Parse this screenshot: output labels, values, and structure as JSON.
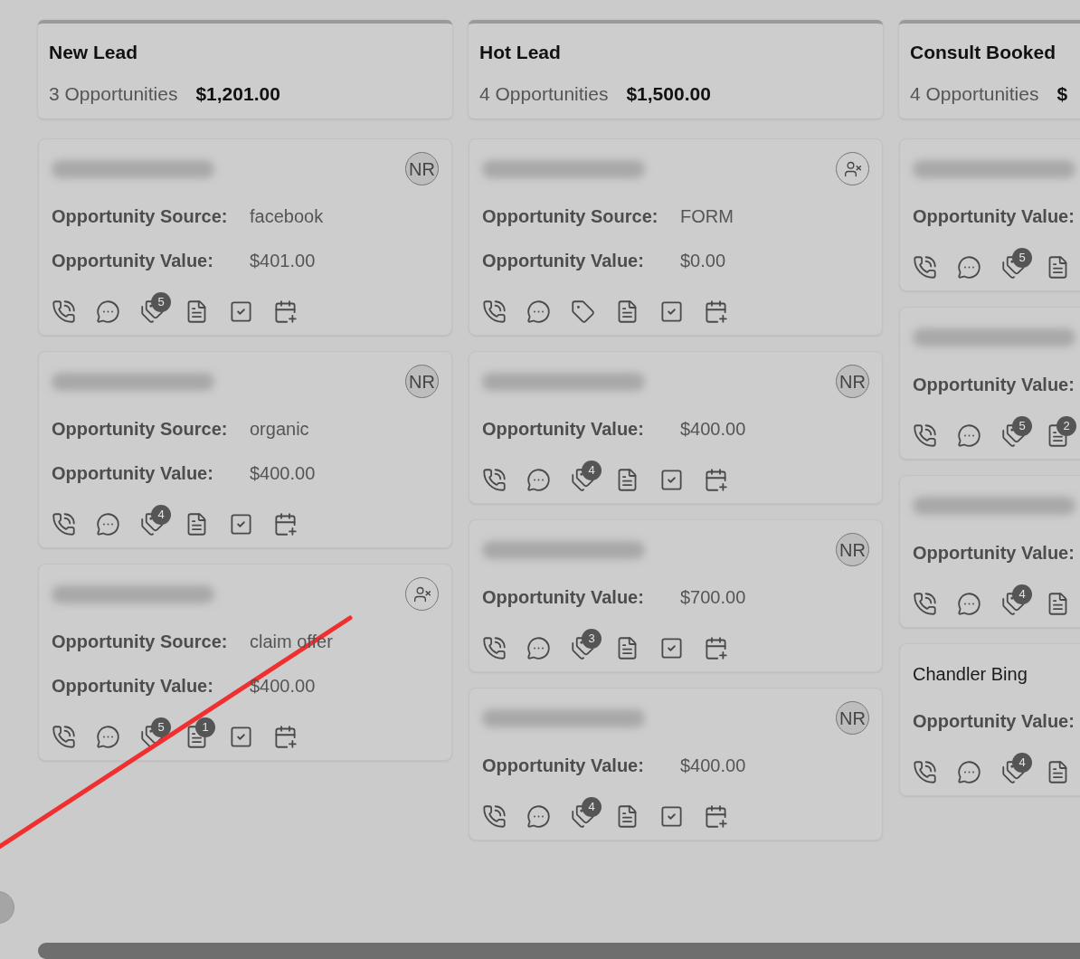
{
  "columns": [
    {
      "title": "New Lead",
      "count": "3 Opportunities",
      "total": "$1,201.00",
      "cards": [
        {
          "avatar": {
            "kind": "initials",
            "text": "NR"
          },
          "fields": [
            {
              "label": "Opportunity Source:",
              "value": "facebook"
            },
            {
              "label": "Opportunity Value:",
              "value": "$401.00"
            }
          ],
          "tag_badge": "5"
        },
        {
          "avatar": {
            "kind": "initials",
            "text": "NR"
          },
          "fields": [
            {
              "label": "Opportunity Source:",
              "value": "organic"
            },
            {
              "label": "Opportunity Value:",
              "value": "$400.00"
            }
          ],
          "tag_badge": "4"
        },
        {
          "avatar": {
            "kind": "unassigned"
          },
          "fields": [
            {
              "label": "Opportunity Source:",
              "value": "claim offer"
            },
            {
              "label": "Opportunity Value:",
              "value": "$400.00"
            }
          ],
          "tag_badge": "5",
          "note_badge": "1"
        }
      ]
    },
    {
      "title": "Hot Lead",
      "count": "4 Opportunities",
      "total": "$1,500.00",
      "cards": [
        {
          "avatar": {
            "kind": "unassigned"
          },
          "fields": [
            {
              "label": "Opportunity Source:",
              "value": "FORM"
            },
            {
              "label": "Opportunity Value:",
              "value": "$0.00"
            }
          ]
        },
        {
          "avatar": {
            "kind": "initials",
            "text": "NR"
          },
          "fields": [
            {
              "label": "Opportunity Value:",
              "value": "$400.00"
            }
          ],
          "tag_badge": "4"
        },
        {
          "avatar": {
            "kind": "initials",
            "text": "NR"
          },
          "fields": [
            {
              "label": "Opportunity Value:",
              "value": "$700.00"
            }
          ],
          "tag_badge": "3"
        },
        {
          "avatar": {
            "kind": "initials",
            "text": "NR"
          },
          "fields": [
            {
              "label": "Opportunity Value:",
              "value": "$400.00"
            }
          ],
          "tag_badge": "4"
        }
      ]
    },
    {
      "title": "Consult Booked",
      "count": "4 Opportunities",
      "total": "$",
      "cards": [
        {
          "fields": [
            {
              "label": "Opportunity Value:"
            }
          ],
          "tag_badge": "5"
        },
        {
          "fields": [
            {
              "label": "Opportunity Value:"
            }
          ],
          "tag_badge": "5",
          "note_badge": "2"
        },
        {
          "fields": [
            {
              "label": "Opportunity Value:"
            }
          ],
          "tag_badge": "4"
        },
        {
          "name": "Chandler Bing",
          "fields": [
            {
              "label": "Opportunity Value:"
            }
          ],
          "tag_badge": "4"
        }
      ]
    }
  ]
}
